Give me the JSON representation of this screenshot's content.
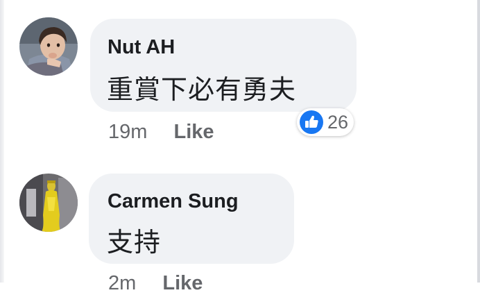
{
  "comments": [
    {
      "author": "Nut AH",
      "text": "重賞下必有勇夫",
      "time": "19m",
      "like_label": "Like",
      "reaction_count": "26",
      "reaction_icon": "thumbs-up-icon",
      "avatar": "child-photo"
    },
    {
      "author": "Carmen Sung",
      "text": "支持",
      "time": "2m",
      "like_label": "Like",
      "avatar": "golden-statue-photo"
    }
  ],
  "colors": {
    "bubble": "#f0f2f5",
    "author": "#1c1e21",
    "meta": "#65676b",
    "like_blue": "#1877f2"
  }
}
